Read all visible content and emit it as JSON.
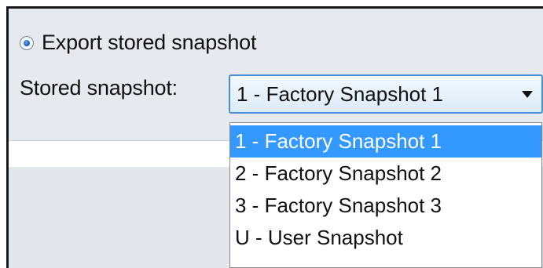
{
  "export_option": {
    "label": "Export stored snapshot",
    "selected": true
  },
  "snapshot_selector": {
    "label": "Stored snapshot:",
    "value": "1 - Factory Snapshot 1",
    "options": [
      "1 - Factory Snapshot 1",
      "2 - Factory Snapshot 2",
      "3 - Factory Snapshot 3",
      "U - User Snapshot"
    ],
    "highlighted_index": 0,
    "arrow_icon": "triangle-down-icon"
  },
  "colors": {
    "highlight": "#3399ff",
    "combo_border": "#4a8fd6",
    "panel_bg": "#e6e9ee"
  }
}
